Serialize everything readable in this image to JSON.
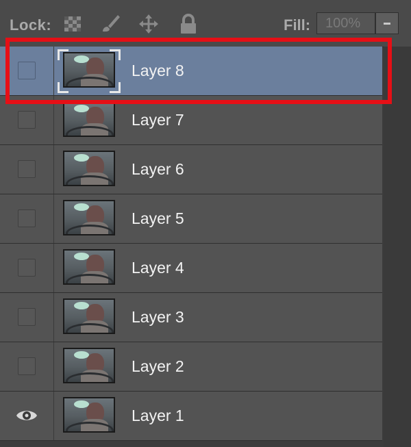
{
  "toolbar": {
    "lock_label": "Lock:",
    "lock_icons": [
      "lock-transparent-pixels-icon",
      "lock-image-pixels-icon",
      "lock-position-icon",
      "lock-all-icon"
    ],
    "fill_label": "Fill:",
    "fill_value": "100%"
  },
  "layers": [
    {
      "name": "Layer 8",
      "visible": false,
      "selected": true
    },
    {
      "name": "Layer 7",
      "visible": false,
      "selected": false
    },
    {
      "name": "Layer 6",
      "visible": false,
      "selected": false
    },
    {
      "name": "Layer 5",
      "visible": false,
      "selected": false
    },
    {
      "name": "Layer 4",
      "visible": false,
      "selected": false
    },
    {
      "name": "Layer 3",
      "visible": false,
      "selected": false
    },
    {
      "name": "Layer 2",
      "visible": false,
      "selected": false
    },
    {
      "name": "Layer 1",
      "visible": true,
      "selected": false
    }
  ],
  "colors": {
    "panel_bg": "#535353",
    "selected_bg": "#6b7f9d",
    "highlight": "#e60f16"
  }
}
